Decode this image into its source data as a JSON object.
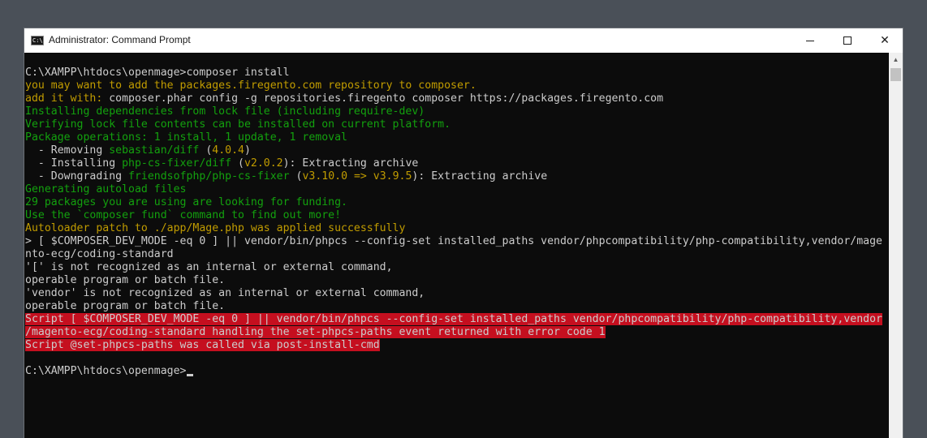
{
  "window": {
    "title": "Administrator: Command Prompt",
    "icon": "cmd-icon",
    "icon_text": "C:\\",
    "close_glyph": "✕"
  },
  "console": {
    "lines": [
      {
        "segs": [
          {
            "t": "C:\\XAMPP\\htdocs\\openmage>composer install",
            "c": "gray"
          }
        ]
      },
      {
        "segs": [
          {
            "t": "you may want to add the packages.firegento.com repository to composer.",
            "c": "yellow"
          }
        ]
      },
      {
        "segs": [
          {
            "t": "add it with:",
            "c": "yellow"
          },
          {
            "t": " composer.phar config -g repositories.firegento composer https://packages.firegento.com",
            "c": "gray"
          }
        ]
      },
      {
        "segs": [
          {
            "t": "Installing dependencies from lock file (including require-dev)",
            "c": "green"
          }
        ]
      },
      {
        "segs": [
          {
            "t": "Verifying lock file contents can be installed on current platform.",
            "c": "green"
          }
        ]
      },
      {
        "segs": [
          {
            "t": "Package operations: 1 install, 1 update, 1 removal",
            "c": "green"
          }
        ]
      },
      {
        "segs": [
          {
            "t": "  - Removing ",
            "c": "gray"
          },
          {
            "t": "sebastian/diff",
            "c": "green"
          },
          {
            "t": " (",
            "c": "gray"
          },
          {
            "t": "4.0.4",
            "c": "yellow"
          },
          {
            "t": ")",
            "c": "gray"
          }
        ]
      },
      {
        "segs": [
          {
            "t": "  - Installing ",
            "c": "gray"
          },
          {
            "t": "php-cs-fixer/diff",
            "c": "green"
          },
          {
            "t": " (",
            "c": "gray"
          },
          {
            "t": "v2.0.2",
            "c": "yellow"
          },
          {
            "t": "): Extracting archive",
            "c": "gray"
          }
        ]
      },
      {
        "segs": [
          {
            "t": "  - Downgrading ",
            "c": "gray"
          },
          {
            "t": "friendsofphp/php-cs-fixer",
            "c": "green"
          },
          {
            "t": " (",
            "c": "gray"
          },
          {
            "t": "v3.10.0 => v3.9.5",
            "c": "yellow"
          },
          {
            "t": "): Extracting archive",
            "c": "gray"
          }
        ]
      },
      {
        "segs": [
          {
            "t": "Generating autoload files",
            "c": "green"
          }
        ]
      },
      {
        "segs": [
          {
            "t": "29 packages you are using are looking for funding.",
            "c": "green"
          }
        ]
      },
      {
        "segs": [
          {
            "t": "Use the `composer fund` command to find out more!",
            "c": "green"
          }
        ]
      },
      {
        "segs": [
          {
            "t": "Autoloader patch to ./app/Mage.php was applied successfully",
            "c": "yellow"
          }
        ]
      },
      {
        "segs": [
          {
            "t": "> [ $COMPOSER_DEV_MODE -eq 0 ] || vendor/bin/phpcs --config-set installed_paths vendor/phpcompatibility/php-compatibility,vendor/mage",
            "c": "gray"
          }
        ]
      },
      {
        "segs": [
          {
            "t": "nto-ecg/coding-standard",
            "c": "gray"
          }
        ]
      },
      {
        "segs": [
          {
            "t": "'[' is not recognized as an internal or external command,",
            "c": "gray"
          }
        ]
      },
      {
        "segs": [
          {
            "t": "operable program or batch file.",
            "c": "gray"
          }
        ]
      },
      {
        "segs": [
          {
            "t": "'vendor' is not recognized as an internal or external command,",
            "c": "gray"
          }
        ]
      },
      {
        "segs": [
          {
            "t": "operable program or batch file.",
            "c": "gray"
          }
        ]
      },
      {
        "segs": [
          {
            "t": "Script [ $COMPOSER_DEV_MODE -eq 0 ] || vendor/bin/phpcs --config-set installed_paths vendor/phpcompatibility/php-compatibility,vendor",
            "c": "err"
          }
        ]
      },
      {
        "segs": [
          {
            "t": "/magento-ecg/coding-standard handling the set-phpcs-paths event returned with error code 1",
            "c": "err"
          }
        ]
      },
      {
        "segs": [
          {
            "t": "Script @set-phpcs-paths was called via post-install-cmd",
            "c": "err"
          }
        ]
      },
      {
        "segs": [
          {
            "t": "",
            "c": "gray"
          }
        ]
      },
      {
        "segs": [
          {
            "t": "C:\\XAMPP\\htdocs\\openmage>",
            "c": "gray"
          }
        ],
        "cursor": true
      }
    ]
  },
  "colors": {
    "gray": "#cccccc",
    "green": "#13a10e",
    "yellow": "#c19c00",
    "error_bg": "#c50f1f",
    "console_bg": "#0c0c0c"
  },
  "scrollbar": {
    "up_arrow": "▲"
  }
}
